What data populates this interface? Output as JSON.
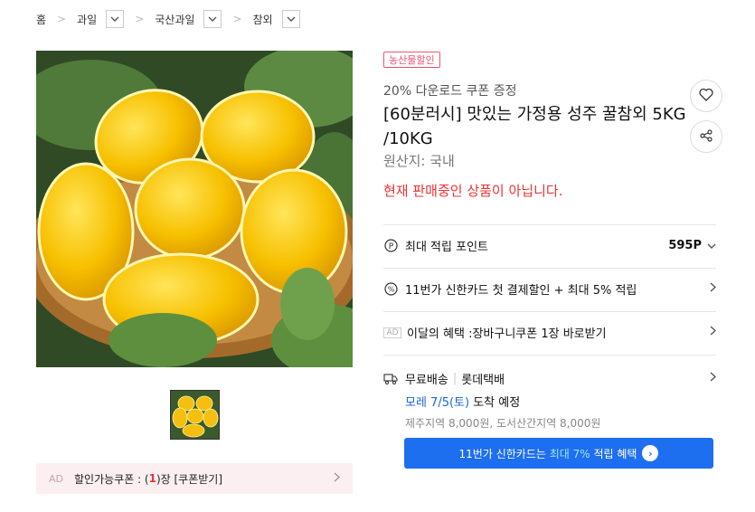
{
  "breadcrumb": {
    "home": "홈",
    "level1": "과일",
    "level2": "국산과일",
    "level3": "참외"
  },
  "coupon_bar": {
    "ad": "AD",
    "text_prefix": "할인가능쿠폰 : (",
    "count": "1",
    "text_suffix": ")장 [쿠폰받기]"
  },
  "product": {
    "badge": "농산물할인",
    "subtitle": "20% 다운로드 쿠폰 증정",
    "title": "[60분러시] 맛있는 가정용 성주 꿀참외 5KG /10KG",
    "origin": "원산지: 국내",
    "status": "현재 판매중인 상품이 아닙니다."
  },
  "benefits": {
    "points_label": "최대 적립 포인트",
    "points_value": "595P",
    "card_offer": "11번가 신한카드 첫 결제할인 + 최대 5% 적립",
    "ad": "AD",
    "monthly_prefix": "이달의 혜택 : ",
    "monthly_text": "장바구니쿠폰 1장 바로받기"
  },
  "shipping": {
    "free": "무료배송",
    "carrier": "롯데택배",
    "arrival_date": "모레 7/5(토)",
    "arrival_suffix": " 도착 예정",
    "extra_fee": "제주지역 8,000원, 도서산간지역 8,000원"
  },
  "cta": {
    "prefix": "11번가 신한카드는 ",
    "highlight": "최대 7%",
    "suffix": " 적립 혜택",
    "go": "›"
  },
  "colors": {
    "accent_blue": "#1e6ff0",
    "sale_red": "#e33333",
    "badge_pink": "#f0536f"
  }
}
